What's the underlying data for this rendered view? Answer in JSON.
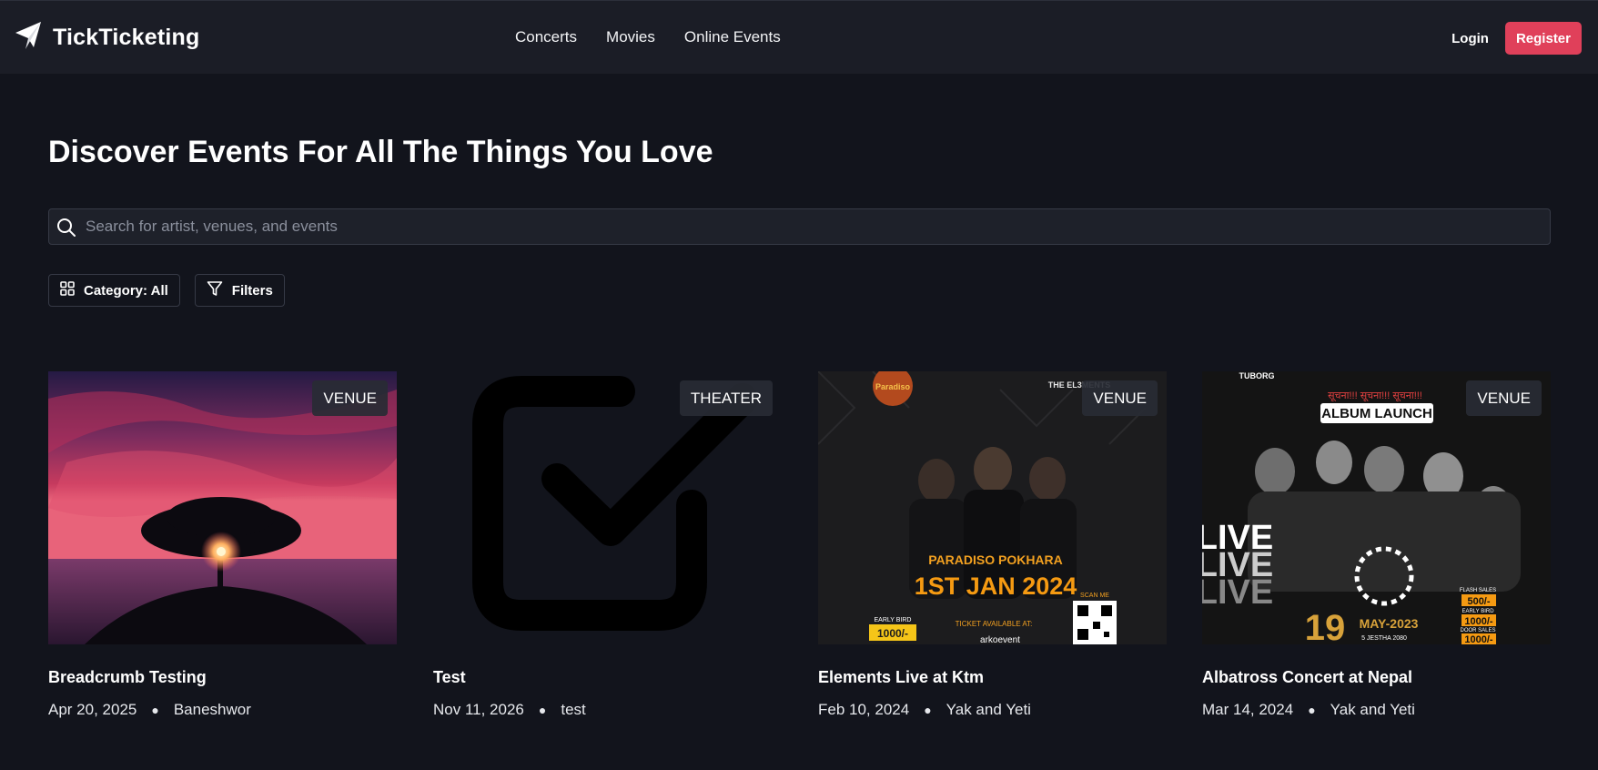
{
  "brand": {
    "name": "TickTicketing",
    "logo_icon": "paper-plane-icon"
  },
  "nav": {
    "links": [
      "Concerts",
      "Movies",
      "Online Events"
    ]
  },
  "auth": {
    "login": "Login",
    "register": "Register",
    "register_color": "#e0405a"
  },
  "hero": {
    "title": "Discover Events For All The Things You Love"
  },
  "search": {
    "placeholder": "Search for artist, venues, and events",
    "value": ""
  },
  "filters": {
    "category": "Category: All",
    "filters": "Filters"
  },
  "events": [
    {
      "title": "Breadcrumb Testing",
      "date": "Apr 20, 2025",
      "location": "Baneshwor",
      "badge": "VENUE",
      "image": "sunset-tree-photo"
    },
    {
      "title": "Test",
      "date": "Nov 11, 2026",
      "location": "test",
      "badge": "THEATER",
      "image": "checkbox-placeholder-icon"
    },
    {
      "title": "Elements Live at Ktm",
      "date": "Feb 10, 2024",
      "location": "Yak and Yeti",
      "badge": "VENUE",
      "image": "concert-poster",
      "poster": {
        "venue_logo": "Paradiso",
        "band_logo": "THE EL3MENTS",
        "headline": "PARADISO POKHARA",
        "date": "1ST JAN 2024",
        "early_bird": "EARLY BIRD",
        "price": "1000/-",
        "tickets": "TICKET AVAILABLE AT:",
        "partner": "arkoevent",
        "scan": "SCAN ME"
      }
    },
    {
      "title": "Albatross Concert at Nepal",
      "date": "Mar 14, 2024",
      "location": "Yak and Yeti",
      "badge": "VENUE",
      "image": "album-launch-poster",
      "poster": {
        "top_left": "TUBORG",
        "headline": "ALBUM LAUNCH",
        "notice": "सूचना!!! सूचना!!! सूचना!!!",
        "live": "LIVE",
        "day": "19",
        "month": "MAY-2023",
        "nepali_date": "5 JESTHA 2080",
        "flash": "FLASH SALES",
        "price1": "500/-",
        "early": "EARLY BIRD",
        "price2": "1000/-",
        "door": "DOOR SALES",
        "price3": "1000/-"
      }
    }
  ]
}
